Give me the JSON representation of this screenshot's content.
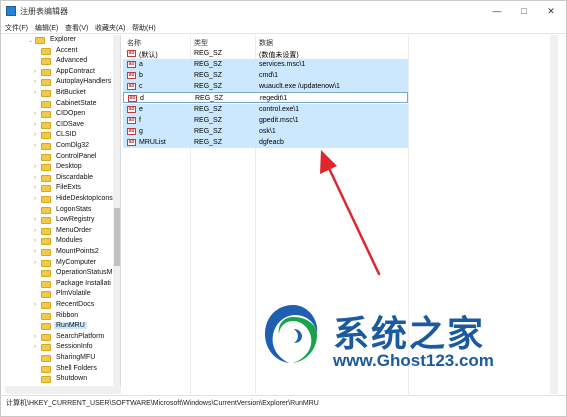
{
  "window": {
    "title": "注册表编辑器",
    "minimize_glyph": "—",
    "maximize_glyph": "□",
    "close_glyph": "✕"
  },
  "menubar": {
    "items": [
      "文件(F)",
      "编辑(E)",
      "查看(V)",
      "收藏夹(A)",
      "帮助(H)"
    ]
  },
  "tree": {
    "items": [
      {
        "label": "Explorer",
        "expander": "⌄"
      },
      {
        "label": "Accent",
        "expander": ""
      },
      {
        "label": "Advanced",
        "expander": ""
      },
      {
        "label": "AppContract",
        "expander": "›"
      },
      {
        "label": "AutoplayHandlers",
        "expander": "›"
      },
      {
        "label": "BitBucket",
        "expander": "›"
      },
      {
        "label": "CabinetState",
        "expander": ""
      },
      {
        "label": "CIDOpen",
        "expander": "›"
      },
      {
        "label": "CIDSave",
        "expander": "›"
      },
      {
        "label": "CLSID",
        "expander": "›"
      },
      {
        "label": "ComDlg32",
        "expander": "›"
      },
      {
        "label": "ControlPanel",
        "expander": ""
      },
      {
        "label": "Desktop",
        "expander": "›"
      },
      {
        "label": "Discardable",
        "expander": "›"
      },
      {
        "label": "FileExts",
        "expander": "›"
      },
      {
        "label": "HideDesktopIcons",
        "expander": "›"
      },
      {
        "label": "LogonStats",
        "expander": ""
      },
      {
        "label": "LowRegistry",
        "expander": "›"
      },
      {
        "label": "MenuOrder",
        "expander": "›"
      },
      {
        "label": "Modules",
        "expander": "›"
      },
      {
        "label": "MountPoints2",
        "expander": "›"
      },
      {
        "label": "MyComputer",
        "expander": "›"
      },
      {
        "label": "OperationStatusM",
        "expander": ""
      },
      {
        "label": "Package Installati",
        "expander": ""
      },
      {
        "label": "PlmVolatile",
        "expander": ""
      },
      {
        "label": "RecentDocs",
        "expander": "›"
      },
      {
        "label": "Ribbon",
        "expander": ""
      },
      {
        "label": "RunMRU",
        "expander": "",
        "selected": true
      },
      {
        "label": "SearchPlatform",
        "expander": "›"
      },
      {
        "label": "SessionInfo",
        "expander": "›"
      },
      {
        "label": "SharingMFU",
        "expander": ""
      },
      {
        "label": "Shell Folders",
        "expander": ""
      },
      {
        "label": "Shutdown",
        "expander": ""
      }
    ]
  },
  "columns": {
    "name": "名称",
    "type": "类型",
    "data": "数据"
  },
  "values": [
    {
      "name": "(默认)",
      "type": "REG_SZ",
      "data": "(数值未设置)",
      "state": "normal"
    },
    {
      "name": "a",
      "type": "REG_SZ",
      "data": "services.msc\\1",
      "state": "highlight"
    },
    {
      "name": "b",
      "type": "REG_SZ",
      "data": "cmd\\1",
      "state": "highlight"
    },
    {
      "name": "c",
      "type": "REG_SZ",
      "data": "wuauclt.exe /updatenow\\1",
      "state": "highlight"
    },
    {
      "name": "d",
      "type": "REG_SZ",
      "data": "regedit\\1",
      "state": "focused"
    },
    {
      "name": "e",
      "type": "REG_SZ",
      "data": "control.exe\\1",
      "state": "highlight"
    },
    {
      "name": "f",
      "type": "REG_SZ",
      "data": "gpedit.msc\\1",
      "state": "highlight"
    },
    {
      "name": "g",
      "type": "REG_SZ",
      "data": "osk\\1",
      "state": "highlight"
    },
    {
      "name": "MRUList",
      "type": "REG_SZ",
      "data": "dgfeacb",
      "state": "highlight"
    }
  ],
  "value_icon_text": "ab",
  "statusbar": {
    "path": "计算机\\HKEY_CURRENT_USER\\SOFTWARE\\Microsoft\\Windows\\CurrentVersion\\Explorer\\RunMRU"
  },
  "watermark": {
    "title": "系统之家",
    "url": "www.Ghost123.com"
  },
  "colors": {
    "selection": "#cce8ff",
    "arrow": "#e0252b",
    "watermark": "#1c5aa0"
  }
}
